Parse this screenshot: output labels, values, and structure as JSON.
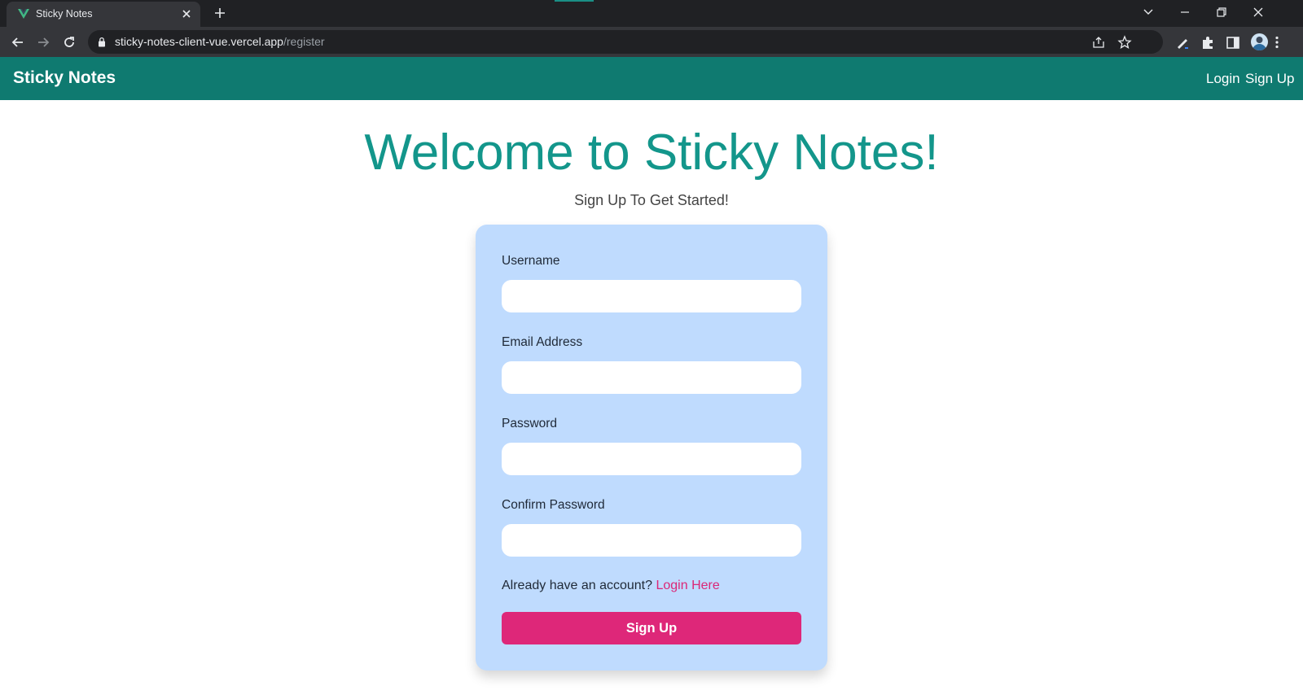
{
  "browser": {
    "tab_title": "Sticky Notes",
    "url_host": "sticky-notes-client-vue.vercel.app",
    "url_path": "/register",
    "accent_color": "#1a8f85"
  },
  "navbar": {
    "brand": "Sticky Notes",
    "links": [
      {
        "label": "Login"
      },
      {
        "label": "Sign Up"
      }
    ],
    "background": "#0f7a70"
  },
  "hero": {
    "title": "Welcome to Sticky Notes!",
    "subtitle": "Sign Up To Get Started!"
  },
  "form": {
    "fields": [
      {
        "label": "Username",
        "value": "",
        "placeholder": ""
      },
      {
        "label": "Email Address",
        "value": "",
        "placeholder": ""
      },
      {
        "label": "Password",
        "value": "",
        "placeholder": ""
      },
      {
        "label": "Confirm Password",
        "value": "",
        "placeholder": ""
      }
    ],
    "account_prompt": "Already have an account?",
    "login_link": "Login Here",
    "submit_label": "Sign Up",
    "card_color": "#bfdbfe",
    "button_color": "#de2779"
  }
}
